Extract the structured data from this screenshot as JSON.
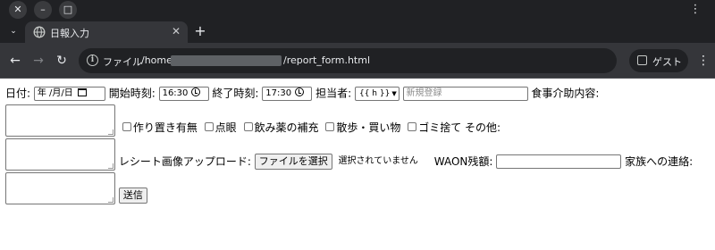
{
  "window": {
    "close_glyph": "✕",
    "minimize_glyph": "–",
    "maximize_glyph": "□",
    "menu_glyph": "⋮"
  },
  "tabs": {
    "list_glyph": "⌄",
    "active_title": "日報入力",
    "close_glyph": "✕",
    "new_tab_glyph": "+"
  },
  "toolbar": {
    "back_glyph": "←",
    "forward_glyph": "→",
    "reload_glyph": "↻",
    "info_glyph": "i",
    "scheme_label": "ファイル",
    "url_prefix": "/home",
    "url_suffix": "/report_form.html",
    "guest_label": "ゲスト",
    "menu_glyph": "⋮"
  },
  "form": {
    "date_label": "日付:",
    "date_value": "年 /月/日",
    "start_label": "開始時刻:",
    "start_value": "16:30",
    "end_label": "終了時刻:",
    "end_value": "17:30",
    "staff_label": "担当者:",
    "staff_selected": "{{ h }}",
    "new_staff_placeholder": "新規登録",
    "meal_label": "食事介助内容:",
    "checkboxes": [
      "作り置き有無",
      "点眼",
      "飲み薬の補充",
      "散歩・買い物",
      "ゴミ捨て"
    ],
    "other_label": "その他:",
    "receipt_label": "レシート画像アップロード:",
    "file_button": "ファイルを選択",
    "file_status": "選択されていません",
    "waon_label": "WAON残額:",
    "family_label": "家族への連絡:",
    "submit_label": "送信"
  },
  "icons": {
    "tab_favicon": "globe-icon",
    "info": "info-icon",
    "guest": "guest-profile-icon",
    "date_picker": "calendar-icon",
    "time_picker": "clock-icon"
  }
}
